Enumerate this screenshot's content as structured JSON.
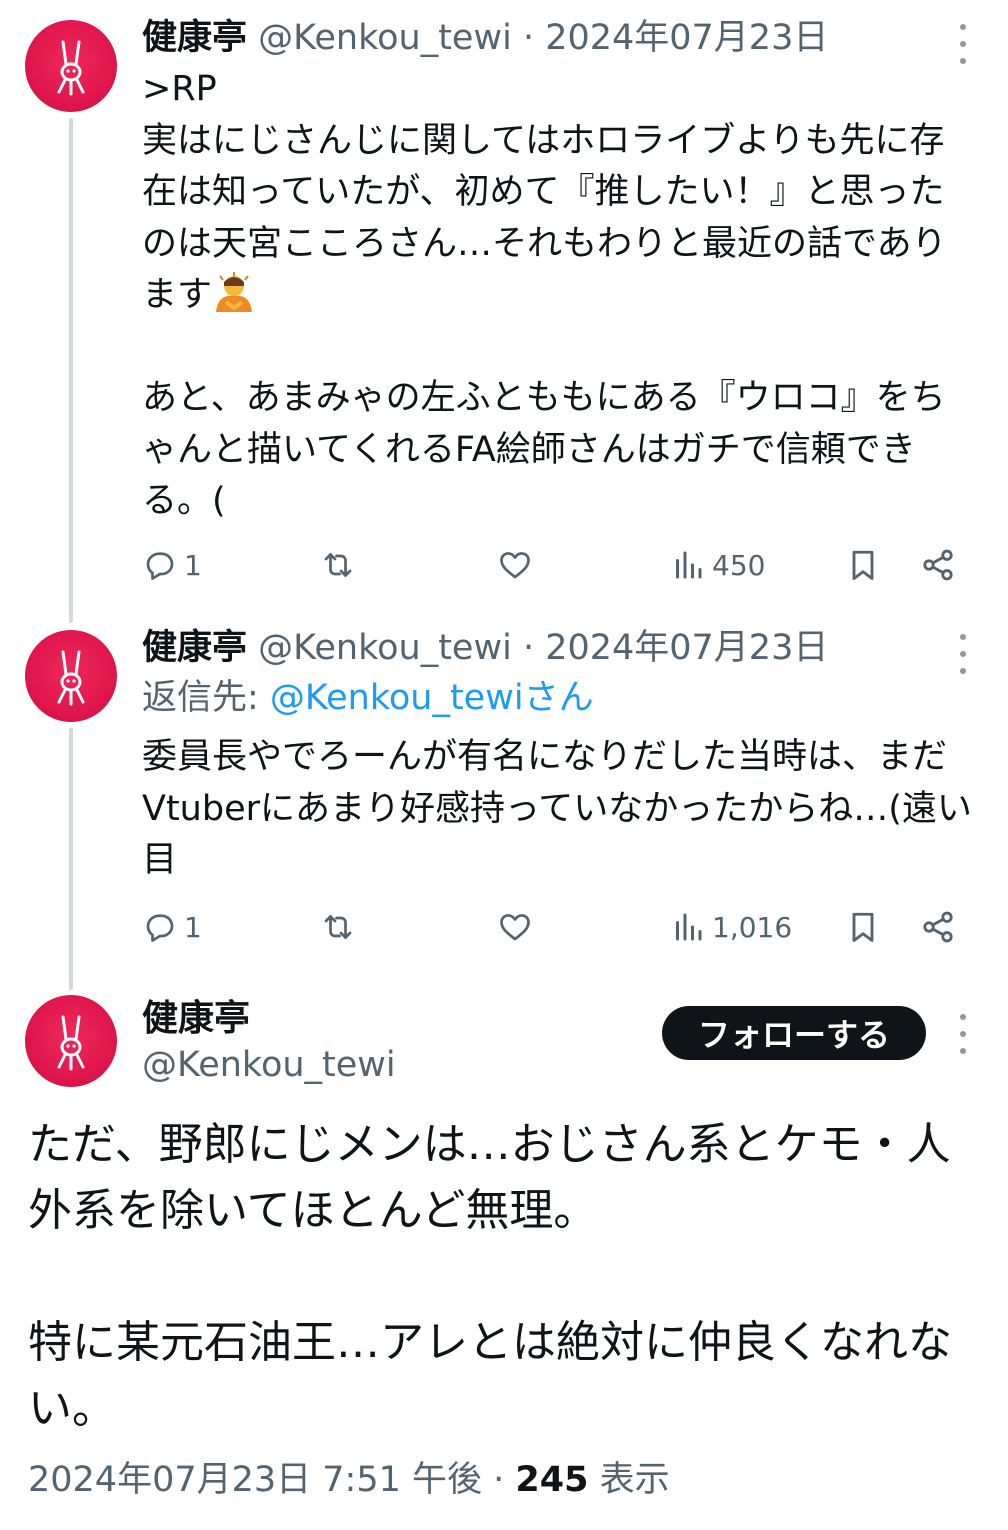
{
  "tweets": [
    {
      "name": "健康亭",
      "handle": "@Kenkou_tewi",
      "sep": " · ",
      "date": "2024年07月23日",
      "text_part1": ">RP\n実はにじさんじに関してはホロライブよりも先に存在は知っていたが、初めて『推したい！』と思ったのは天宮こころさん…それもわりと最近の話であります",
      "emoji": "person-bowing-emoji",
      "text_part2": "\n\nあと、あまみゃの左ふとももにある『ウロコ』をちゃんと描いてくれるFA絵師さんはガチで信頼できる。(",
      "replies": "1",
      "retweets": "",
      "likes": "",
      "views": "450"
    },
    {
      "name": "健康亭",
      "handle": "@Kenkou_tewi",
      "sep": " · ",
      "date": "2024年07月23日",
      "reply_prefix": "返信先: ",
      "reply_target": "@Kenkou_tewiさん",
      "text": "委員長やでろーんが有名になりだした当時は、まだVtuberにあまり好感持っていなかったからね…(遠い目",
      "replies": "1",
      "retweets": "",
      "likes": "",
      "views": "1,016"
    }
  ],
  "main_tweet": {
    "name": "健康亭",
    "handle": "@Kenkou_tewi",
    "follow_label": "フォローする",
    "text": "ただ、野郎にじメンは…おじさん系とケモ・人外系を除いてほとんど無理。\n\n特に某元石油王…アレとは絶対に仲良くなれない。",
    "timestamp": "2024年07月23日 7:51 午後",
    "sep": " · ",
    "views_count": "245",
    "views_label": " 表示"
  },
  "icons": {
    "reply": "reply-bubble-icon",
    "retweet": "retweet-icon",
    "like": "heart-icon",
    "views": "bar-chart-icon",
    "bookmark": "bookmark-icon",
    "share": "share-icon",
    "more": "more-vertical-icon"
  },
  "colors": {
    "text": "#0f1419",
    "secondary": "#536471",
    "link": "#1d9bf0",
    "avatar_bg": "#e0164c",
    "thread_line": "#cfd9de",
    "follow_bg": "#0f1419"
  }
}
